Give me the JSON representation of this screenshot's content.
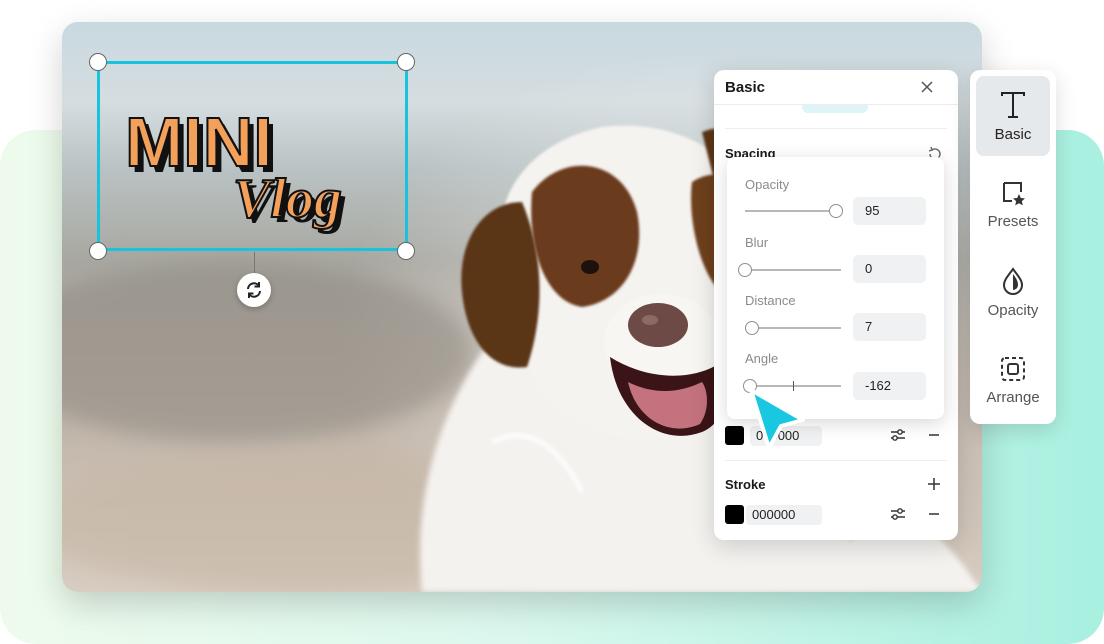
{
  "canvas": {
    "logo": {
      "line1": "MINI",
      "line2": "Vlog",
      "fill_color": "#f3a05a",
      "shadow_color": "#111111"
    }
  },
  "panel": {
    "title": "Basic",
    "spacing_label": "Spacing",
    "shadow": {
      "color_hex": "000000",
      "swatch_color": "#000000"
    },
    "stroke": {
      "label": "Stroke",
      "color_hex": "000000",
      "swatch_color": "#000000"
    }
  },
  "shadow_popover": {
    "sliders": [
      {
        "label": "Opacity",
        "value": "95",
        "level": 0.95
      },
      {
        "label": "Blur",
        "value": "0",
        "level": 0.0
      },
      {
        "label": "Distance",
        "value": "7",
        "level": 0.07
      },
      {
        "label": "Angle",
        "value": "-162",
        "level": 0.05
      }
    ]
  },
  "toolbar": {
    "items": [
      {
        "label": "Basic",
        "icon": "text-icon",
        "active": true
      },
      {
        "label": "Presets",
        "icon": "preset-star-icon",
        "active": false
      },
      {
        "label": "Opacity",
        "icon": "opacity-drop-icon",
        "active": false
      },
      {
        "label": "Arrange",
        "icon": "arrange-icon",
        "active": false
      }
    ]
  },
  "colors": {
    "accent": "#17c3df",
    "cursor": "#19c7e0"
  }
}
